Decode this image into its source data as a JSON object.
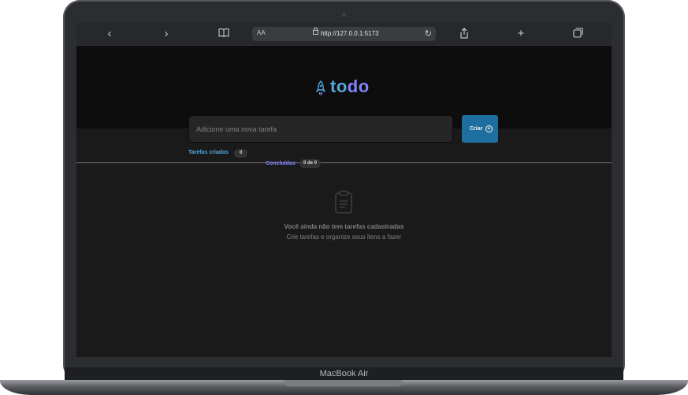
{
  "device": {
    "label": "MacBook Air"
  },
  "browser": {
    "text_size_label": "AA",
    "url": "http://127.0.0.1:5173",
    "icons": [
      "chevron-left-icon",
      "chevron-right-icon",
      "book-icon",
      "lock-icon",
      "reload-icon",
      "share-icon",
      "plus-icon",
      "tabs-icon"
    ]
  },
  "app": {
    "logo": {
      "part1": "to",
      "part2": "do"
    },
    "input": {
      "placeholder": "Adicione uma nova tarefa",
      "value": ""
    },
    "create_button": {
      "label": "Criar"
    },
    "stats": {
      "created_label": "Tarefas criadas",
      "created_count": "0",
      "done_label": "Concluídas",
      "done_count": "0 de 0"
    },
    "empty": {
      "title": "Você ainda não tem tarefas cadastradas",
      "subtitle": "Crie tarefas e organize seus itens a fazer"
    },
    "colors": {
      "blue": "#4ea8de",
      "purple": "#8284fa",
      "button": "#1e6f9f"
    }
  }
}
